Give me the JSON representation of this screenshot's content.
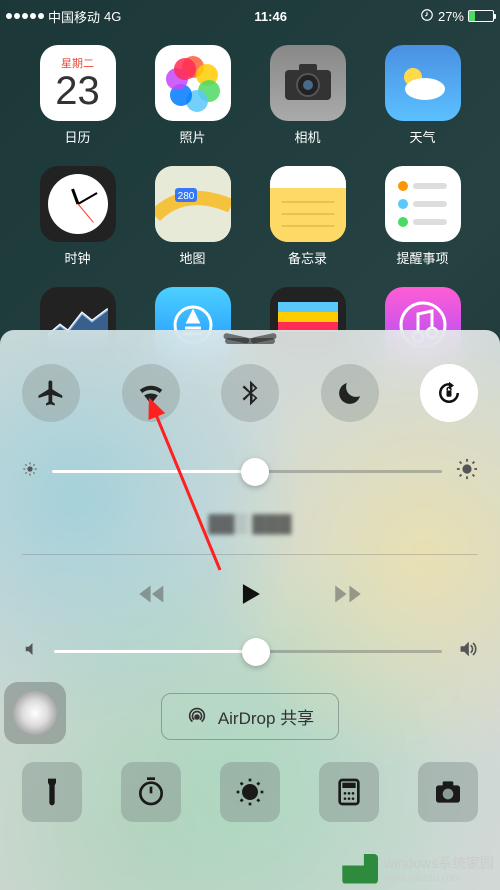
{
  "status_bar": {
    "carrier": "中国移动",
    "network": "4G",
    "time": "11:46",
    "battery_pct": "27%"
  },
  "home": {
    "apps": [
      {
        "label": "日历",
        "dow": "星期二",
        "day": "23"
      },
      {
        "label": "照片"
      },
      {
        "label": "相机"
      },
      {
        "label": "天气"
      },
      {
        "label": "时钟"
      },
      {
        "label": "地图"
      },
      {
        "label": "备忘录"
      },
      {
        "label": "提醒事项"
      }
    ]
  },
  "control_center": {
    "toggles": {
      "airplane": "airplane-mode",
      "wifi": "wifi",
      "bluetooth": "bluetooth",
      "dnd": "do-not-disturb",
      "orientation_lock": "orientation-lock",
      "orientation_lock_active": true
    },
    "brightness_pct": 52,
    "now_playing": "",
    "volume_pct": 52,
    "airdrop_label": "AirDrop 共享",
    "quick": [
      "flashlight",
      "timer",
      "night-shift",
      "calculator",
      "camera"
    ]
  },
  "watermark": {
    "text": "windows系统家园",
    "url": "www.rubaitu.com"
  }
}
